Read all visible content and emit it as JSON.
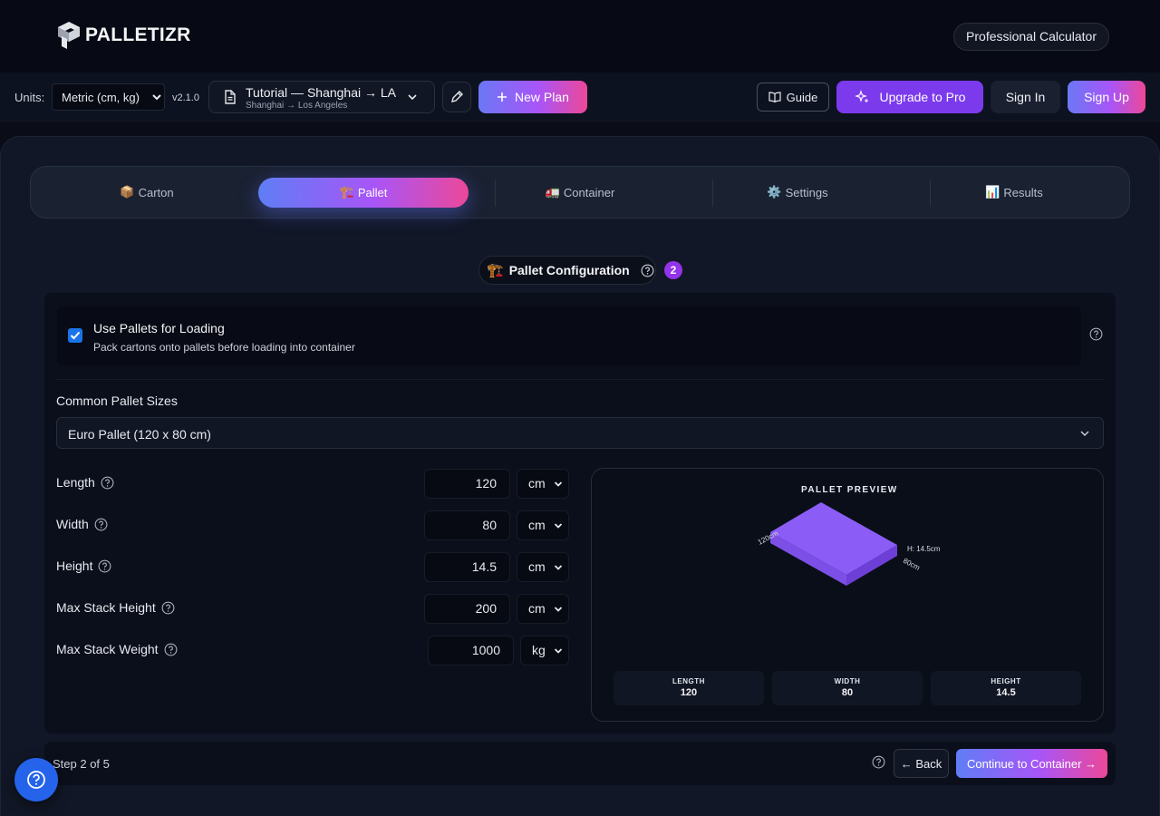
{
  "brand": {
    "name": "PALLETIZR"
  },
  "header": {
    "pro_label": "Professional Calculator"
  },
  "toolbar": {
    "units_label": "Units:",
    "units_value": "Metric (cm, kg)",
    "version": "v2.1.0",
    "plan_title": "Tutorial — Shanghai → LA",
    "plan_route": "Shanghai → Los Angeles",
    "new_plan": "New Plan",
    "guide": "Guide",
    "upgrade": "Upgrade to Pro",
    "sign_in": "Sign In",
    "sign_up": "Sign Up"
  },
  "tabs": [
    {
      "icon": "📦",
      "label": "Carton"
    },
    {
      "icon": "🏗️",
      "label": "Pallet"
    },
    {
      "icon": "🚛",
      "label": "Container"
    },
    {
      "icon": "⚙️",
      "label": "Settings"
    },
    {
      "icon": "📊",
      "label": "Results"
    }
  ],
  "section": {
    "icon": "🏗️",
    "title": "Pallet Configuration",
    "step_badge": "2"
  },
  "use_pallets": {
    "checked": true,
    "title": "Use Pallets for Loading",
    "description": "Pack cartons onto pallets before loading into container"
  },
  "common_sizes": {
    "label": "Common Pallet Sizes",
    "value": "Euro Pallet (120 x 80 cm)"
  },
  "fields": {
    "length": {
      "label": "Length",
      "value": "120",
      "unit": "cm"
    },
    "width": {
      "label": "Width",
      "value": "80",
      "unit": "cm"
    },
    "height": {
      "label": "Height",
      "value": "14.5",
      "unit": "cm"
    },
    "max_stack_height": {
      "label": "Max Stack Height",
      "value": "200",
      "unit": "cm"
    },
    "max_stack_weight": {
      "label": "Max Stack Weight",
      "value": "1000",
      "unit": "kg"
    }
  },
  "preview": {
    "title": "PALLET PREVIEW",
    "length_tag": "120cm",
    "width_tag": "80cm",
    "height_tag": "H: 14.5cm",
    "color": "#8b5cf6",
    "stats": [
      {
        "label": "LENGTH",
        "value": "120"
      },
      {
        "label": "WIDTH",
        "value": "80"
      },
      {
        "label": "HEIGHT",
        "value": "14.5"
      }
    ]
  },
  "footer": {
    "step_text": "Step 2 of 5",
    "back": "← Back",
    "continue": "Continue to Container →"
  },
  "colors": {
    "accent_start": "#6b78f5",
    "accent_mid": "#a855f7",
    "accent_end": "#ec4899",
    "upgrade": "#7c3aed",
    "help_fab": "#2563eb"
  }
}
